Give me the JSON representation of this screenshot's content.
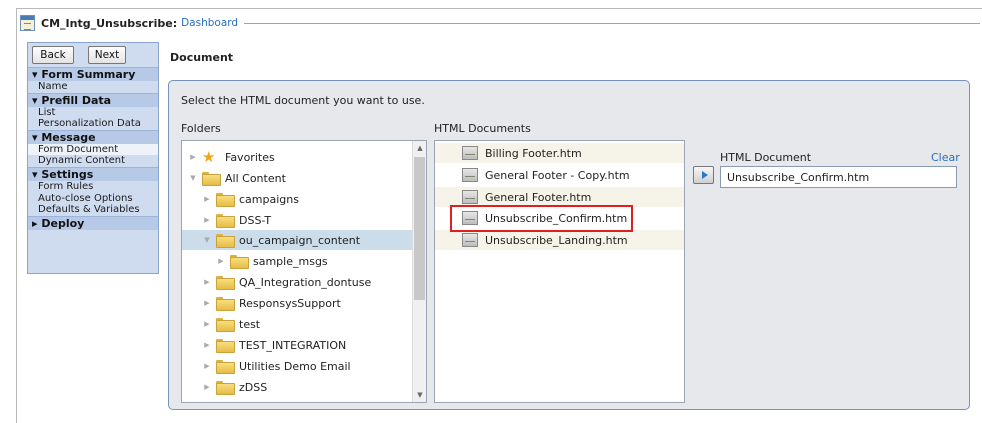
{
  "header": {
    "title": "CM_Intg_Unsubscribe:",
    "breadcrumb": "Dashboard"
  },
  "nav": {
    "back": "Back",
    "next": "Next"
  },
  "sidebar": {
    "sections": [
      {
        "label": "▾ Form Summary",
        "items": [
          "Name"
        ]
      },
      {
        "label": "▾ Prefill Data",
        "items": [
          "List",
          "Personalization Data"
        ]
      },
      {
        "label": "▾ Message",
        "items": [
          "Form Document",
          "Dynamic Content"
        ]
      },
      {
        "label": "▾ Settings",
        "items": [
          "Form Rules",
          "Auto-close Options",
          "Defaults & Variables"
        ]
      },
      {
        "label": "▸ Deploy",
        "items": []
      }
    ],
    "selected_item": "Form Document"
  },
  "main": {
    "title": "Document",
    "instruction": "Select the HTML document you want to use.",
    "folders_label": "Folders",
    "docs_label": "HTML Documents",
    "folders": [
      {
        "label": "Favorites",
        "icon": "star-icon",
        "depth": 0
      },
      {
        "label": "All Content",
        "icon": "folder-icon",
        "depth": 0,
        "expanded": true
      },
      {
        "label": "campaigns",
        "icon": "folder-icon",
        "depth": 1
      },
      {
        "label": "DSS-T",
        "icon": "folder-icon",
        "depth": 1
      },
      {
        "label": "ou_campaign_content",
        "icon": "folder-icon",
        "depth": 1,
        "expanded": true,
        "selected": true
      },
      {
        "label": "sample_msgs",
        "icon": "folder-icon",
        "depth": 2
      },
      {
        "label": "QA_Integration_dontuse",
        "icon": "folder-icon",
        "depth": 1
      },
      {
        "label": "ResponsysSupport",
        "icon": "folder-icon",
        "depth": 1
      },
      {
        "label": "test",
        "icon": "folder-icon",
        "depth": 1
      },
      {
        "label": "TEST_INTEGRATION",
        "icon": "folder-icon",
        "depth": 1
      },
      {
        "label": "Utilities Demo Email",
        "icon": "folder-icon",
        "depth": 1
      },
      {
        "label": "zDSS",
        "icon": "folder-icon",
        "depth": 1
      }
    ],
    "documents": [
      "Billing Footer.htm",
      "General Footer - Copy.htm",
      "General Footer.htm",
      "Unsubscribe_Confirm.htm",
      "Unsubscribe_Landing.htm"
    ],
    "highlighted_document": "Unsubscribe_Confirm.htm",
    "html_document_label": "HTML Document",
    "clear_label": "Clear",
    "html_document_value": "Unsubscribe_Confirm.htm"
  },
  "colors": {
    "accent": "#2a6ec0",
    "highlight": "#e02020",
    "sidebar_bg": "#cfdcf0",
    "header_line": "#8bc34a"
  }
}
